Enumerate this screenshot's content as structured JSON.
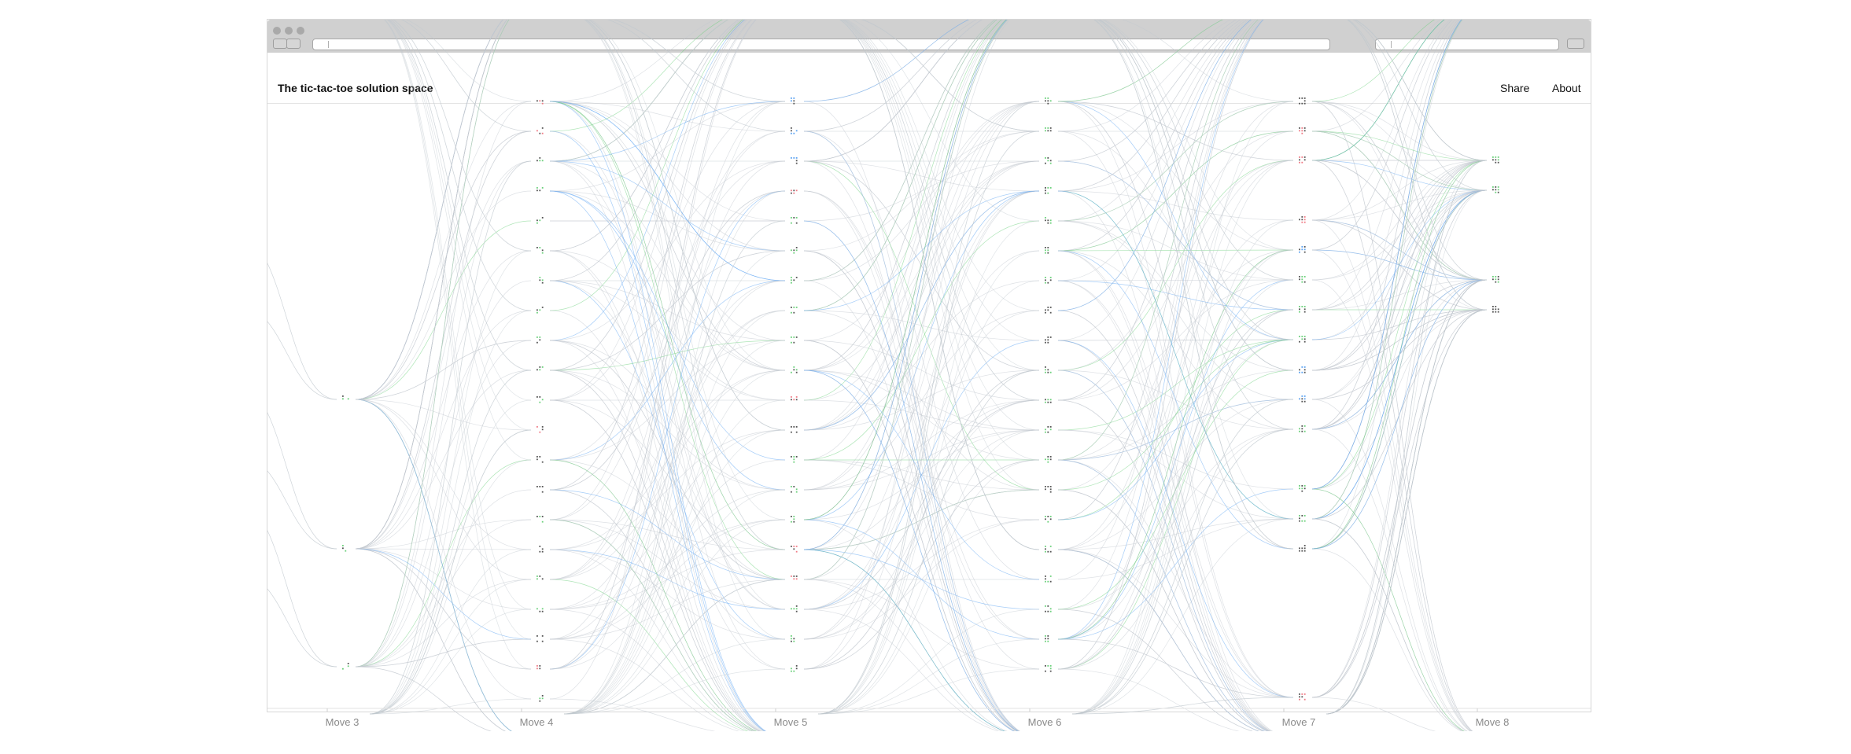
{
  "header": {
    "title": "The tic-tac-toe solution space"
  },
  "nav": {
    "share": "Share",
    "about": "About"
  },
  "axis": {
    "move_labels": [
      "Move 3",
      "Move 4",
      "Move 5",
      "Move 6",
      "Move 7",
      "Move 8"
    ]
  },
  "colors": {
    "x_win": "#f07b86",
    "o_win": "#5da4f2",
    "draw": "#6bd07b",
    "link": "#c2c9cf",
    "board_dot": "#555555"
  },
  "columns": [
    {
      "move": 3,
      "outcomes": [
        "draw",
        "draw",
        "draw"
      ]
    },
    {
      "move": 4,
      "outcomes": [
        "x_win",
        "x_win",
        "draw",
        "draw",
        "draw",
        "draw",
        "draw",
        "draw",
        "draw",
        "draw",
        "draw",
        "x_win",
        "neutral",
        "neutral",
        "draw",
        "neutral",
        "draw",
        "draw",
        "neutral",
        "x_win",
        "draw"
      ]
    },
    {
      "move": 5,
      "outcomes": [
        "o_win",
        "o_win",
        "o_win",
        "x_win",
        "draw",
        "draw",
        "draw",
        "draw",
        "draw",
        "draw",
        "x_win",
        "neutral",
        "draw",
        "draw",
        "draw",
        "x_win",
        "x_win",
        "draw",
        "draw",
        "draw"
      ]
    },
    {
      "move": 6,
      "outcomes": [
        "draw",
        "draw",
        "draw",
        "draw",
        "draw",
        "draw",
        "draw",
        "neutral",
        "neutral",
        "draw",
        "draw",
        "draw",
        "draw",
        "neutral",
        "draw",
        "draw",
        "draw",
        "draw",
        "draw",
        "draw"
      ]
    },
    {
      "move": 7,
      "outcomes": [
        "neutral",
        "x_win",
        "x_win",
        "x_win",
        "o_win",
        "draw",
        "draw",
        "draw",
        "o_win",
        "o_win",
        "draw",
        "draw",
        "draw",
        "neutral",
        "x_win"
      ]
    },
    {
      "move": 8,
      "outcomes": [
        "draw",
        "draw",
        "draw",
        "neutral"
      ]
    }
  ]
}
